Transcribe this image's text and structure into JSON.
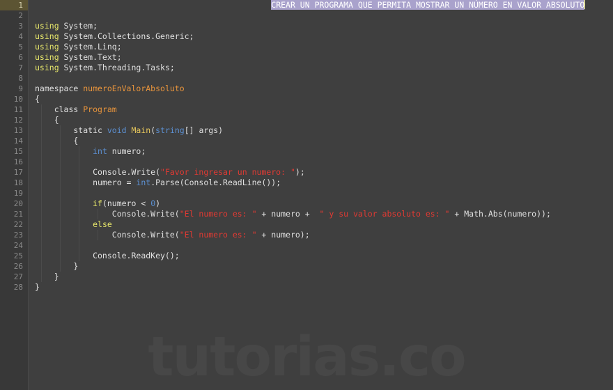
{
  "editor": {
    "watermark": "tutorias.co",
    "language": "csharp",
    "colors": {
      "background": "#3f3f3f",
      "gutter_background": "#383838",
      "gutter_active": "#5c5433",
      "line_number": "#8a8a8a",
      "foreground": "#e0e0e0",
      "keyword": "#e8e86b",
      "type": "#5c90d2",
      "identifier": "#e8943c",
      "function": "#e8c85c",
      "string": "#e03a33",
      "selection": "#a9a2cc",
      "caret": "#e8e86b",
      "indent_guide": "#4b4b4b"
    },
    "selection_text": "CREAR UN PROGRAMA QUE PERMITA MOSTRAR UN NÚMERO EN VALOR ABSOLUTO",
    "active_line": 1,
    "first_line": 1,
    "last_line": 28,
    "lines": [
      {
        "n": "1",
        "guides": [],
        "tokens": [
          {
            "t": "                                                 ",
            "c": "t-plain"
          },
          {
            "t": "CREAR UN PROGRAMA QUE PERMITA MOSTRAR UN NÚMERO EN VALOR ABSOLUTO",
            "c": "sel"
          }
        ]
      },
      {
        "n": "2",
        "guides": [],
        "tokens": []
      },
      {
        "n": "3",
        "guides": [],
        "tokens": [
          {
            "t": "using",
            "c": "t-key"
          },
          {
            "t": " System;",
            "c": "t-plain"
          }
        ]
      },
      {
        "n": "4",
        "guides": [],
        "tokens": [
          {
            "t": "using",
            "c": "t-key"
          },
          {
            "t": " System.Collections.Generic;",
            "c": "t-plain"
          }
        ]
      },
      {
        "n": "5",
        "guides": [],
        "tokens": [
          {
            "t": "using",
            "c": "t-key"
          },
          {
            "t": " System.Linq;",
            "c": "t-plain"
          }
        ]
      },
      {
        "n": "6",
        "guides": [],
        "tokens": [
          {
            "t": "using",
            "c": "t-key"
          },
          {
            "t": " System.Text;",
            "c": "t-plain"
          }
        ]
      },
      {
        "n": "7",
        "guides": [],
        "tokens": [
          {
            "t": "using",
            "c": "t-key"
          },
          {
            "t": " System.Threading.Tasks;",
            "c": "t-plain"
          }
        ]
      },
      {
        "n": "8",
        "guides": [],
        "tokens": []
      },
      {
        "n": "9",
        "guides": [],
        "tokens": [
          {
            "t": "namespace",
            "c": "t-plain"
          },
          {
            "t": " ",
            "c": "t-plain"
          },
          {
            "t": "numeroEnValorAbsoluto",
            "c": "t-ident"
          }
        ]
      },
      {
        "n": "10",
        "guides": [],
        "tokens": [
          {
            "t": "{",
            "c": "t-plain"
          }
        ]
      },
      {
        "n": "11",
        "guides": [
          9
        ],
        "tokens": [
          {
            "t": "    class ",
            "c": "t-plain"
          },
          {
            "t": "Program",
            "c": "t-ident"
          }
        ]
      },
      {
        "n": "12",
        "guides": [
          9
        ],
        "tokens": [
          {
            "t": "    {",
            "c": "t-plain"
          }
        ]
      },
      {
        "n": "13",
        "guides": [
          9,
          36
        ],
        "tokens": [
          {
            "t": "        static ",
            "c": "t-plain"
          },
          {
            "t": "void",
            "c": "t-type"
          },
          {
            "t": " ",
            "c": "t-plain"
          },
          {
            "t": "Main",
            "c": "t-fn"
          },
          {
            "t": "(",
            "c": "t-plain"
          },
          {
            "t": "string",
            "c": "t-type"
          },
          {
            "t": "[] args)",
            "c": "t-plain"
          }
        ]
      },
      {
        "n": "14",
        "guides": [
          9,
          36
        ],
        "tokens": [
          {
            "t": "        {",
            "c": "t-plain"
          }
        ]
      },
      {
        "n": "15",
        "guides": [
          9,
          36,
          63
        ],
        "tokens": [
          {
            "t": "            ",
            "c": "t-plain"
          },
          {
            "t": "int",
            "c": "t-type"
          },
          {
            "t": " numero;",
            "c": "t-plain"
          }
        ]
      },
      {
        "n": "16",
        "guides": [
          9,
          36,
          63
        ],
        "tokens": []
      },
      {
        "n": "17",
        "guides": [
          9,
          36,
          63
        ],
        "tokens": [
          {
            "t": "            Console.Write(",
            "c": "t-plain"
          },
          {
            "t": "\"Favor ingresar un numero: \"",
            "c": "t-str"
          },
          {
            "t": ");",
            "c": "t-plain"
          }
        ]
      },
      {
        "n": "18",
        "guides": [
          9,
          36,
          63
        ],
        "tokens": [
          {
            "t": "            numero = ",
            "c": "t-plain"
          },
          {
            "t": "int",
            "c": "t-type"
          },
          {
            "t": ".Parse(Console.ReadLine());",
            "c": "t-plain"
          }
        ]
      },
      {
        "n": "19",
        "guides": [
          9,
          36,
          63
        ],
        "tokens": []
      },
      {
        "n": "20",
        "guides": [
          9,
          36,
          63
        ],
        "tokens": [
          {
            "t": "            ",
            "c": "t-plain"
          },
          {
            "t": "if",
            "c": "t-key"
          },
          {
            "t": "(numero < ",
            "c": "t-plain"
          },
          {
            "t": "0",
            "c": "t-num"
          },
          {
            "t": ")",
            "c": "t-plain"
          }
        ]
      },
      {
        "n": "21",
        "guides": [
          9,
          36,
          63,
          90
        ],
        "tokens": [
          {
            "t": "                Console.Write(",
            "c": "t-plain"
          },
          {
            "t": "\"El numero es: \"",
            "c": "t-str"
          },
          {
            "t": " + numero + ",
            "c": "t-plain"
          },
          {
            "t": " \" y su valor absoluto es: \"",
            "c": "t-str"
          },
          {
            "t": " + Math.Abs(numero));",
            "c": "t-plain"
          }
        ]
      },
      {
        "n": "22",
        "guides": [
          9,
          36,
          63
        ],
        "tokens": [
          {
            "t": "            ",
            "c": "t-plain"
          },
          {
            "t": "else",
            "c": "t-key"
          }
        ]
      },
      {
        "n": "23",
        "guides": [
          9,
          36,
          63,
          90
        ],
        "tokens": [
          {
            "t": "                Console.Write(",
            "c": "t-plain"
          },
          {
            "t": "\"El numero es: \"",
            "c": "t-str"
          },
          {
            "t": " + numero);",
            "c": "t-plain"
          }
        ]
      },
      {
        "n": "24",
        "guides": [
          9,
          36,
          63
        ],
        "tokens": []
      },
      {
        "n": "25",
        "guides": [
          9,
          36,
          63
        ],
        "tokens": [
          {
            "t": "            Console.ReadKey();",
            "c": "t-plain"
          }
        ]
      },
      {
        "n": "26",
        "guides": [
          9,
          36
        ],
        "tokens": [
          {
            "t": "        }",
            "c": "t-plain"
          }
        ]
      },
      {
        "n": "27",
        "guides": [
          9
        ],
        "tokens": [
          {
            "t": "    }",
            "c": "t-plain"
          }
        ]
      },
      {
        "n": "28",
        "guides": [],
        "tokens": [
          {
            "t": "}",
            "c": "t-plain"
          }
        ]
      }
    ]
  }
}
